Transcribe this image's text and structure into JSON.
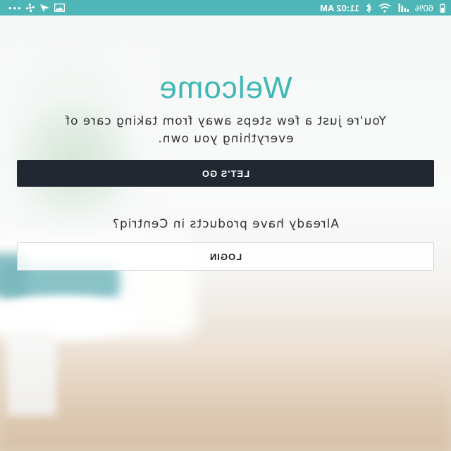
{
  "status_bar": {
    "time": "11:02 AM",
    "battery_percent": "60%",
    "background_color": "#4fb6b7",
    "left_icons": [
      "battery-icon",
      "signal-icon",
      "wifi-icon",
      "bluetooth-icon"
    ],
    "right_icons": [
      "more-icon",
      "fan-icon",
      "navigation-icon",
      "image-icon"
    ]
  },
  "welcome": {
    "title": "Welcome",
    "subtitle": "You're just a few steps away from taking care of everything you own."
  },
  "primary_button": {
    "label": "LET'S GO"
  },
  "login_prompt": "Already have products in Centriq?",
  "login_button": {
    "label": "LOGIN"
  },
  "colors": {
    "accent": "#3fb8b5",
    "primary_button": "#222831"
  }
}
